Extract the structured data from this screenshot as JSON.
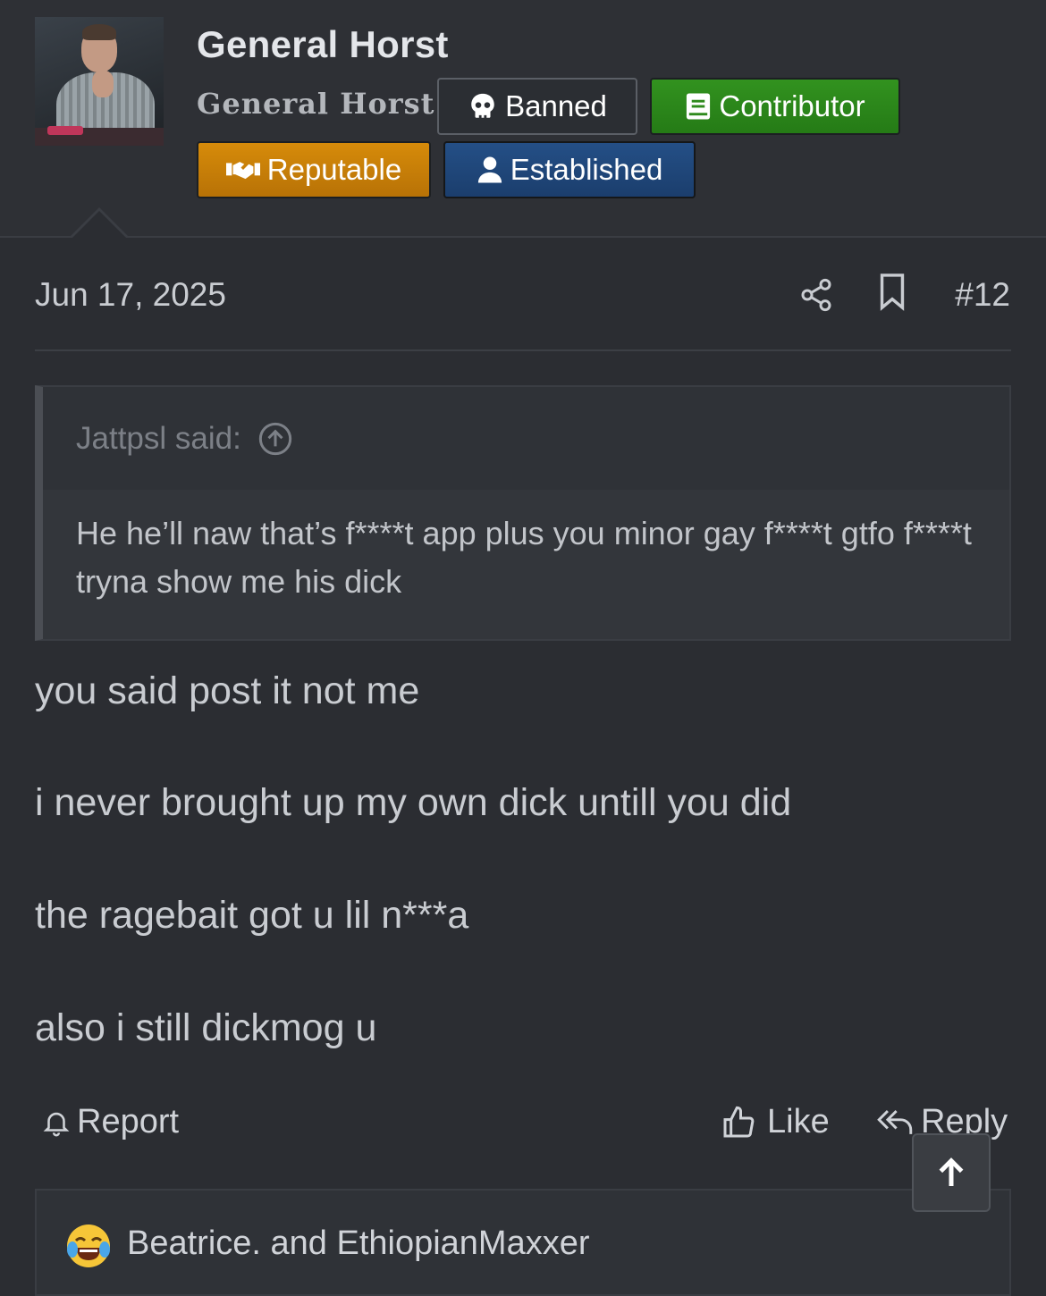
{
  "user": {
    "name": "General Horst",
    "title": "General Horst",
    "badges": [
      {
        "label": "Banned",
        "icon": "skull-icon",
        "color": "#2b2e33"
      },
      {
        "label": "Contributor",
        "icon": "book-icon",
        "color": "#2e8a1c"
      },
      {
        "label": "Reputable",
        "icon": "handshake-icon",
        "color": "#c97e08"
      },
      {
        "label": "Established",
        "icon": "user-icon",
        "color": "#214a7e"
      }
    ]
  },
  "post": {
    "date": "Jun 17, 2025",
    "number": "#12",
    "quote": {
      "author": "Jattpsl said:",
      "text": "He he’ll naw that’s f****t app plus you minor gay f****t gtfo f****t tryna show me his dick"
    },
    "lines": [
      "you said post it not me",
      "i never brought up my own dick untill you did",
      "the ragebait got u lil n***a",
      "also i still dickmog u"
    ]
  },
  "actions": {
    "report": "Report",
    "like": "Like",
    "reply": "Reply"
  },
  "reactions": {
    "emoji_icon": "joy-emoji-icon",
    "text": "Beatrice. and EthiopianMaxxer"
  }
}
